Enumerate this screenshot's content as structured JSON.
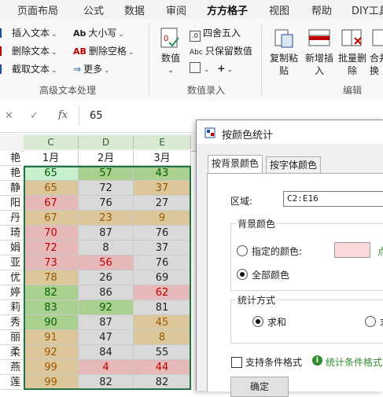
{
  "ribbon": {
    "tabs": [
      "页面布局",
      "公式",
      "数据",
      "审阅",
      "方方格子",
      "视图",
      "帮助",
      "DIY工具"
    ],
    "active_tab": "方方格子",
    "advanced_text": {
      "insert_text": "插入文本",
      "delete_text": "删除文本",
      "cut_text": "截取文本",
      "case": "大小写",
      "delete_spaces": "删除空格",
      "more": "更多",
      "caption": "高级文本处理"
    },
    "numeric": {
      "value": "数值",
      "round": "四舍五入",
      "keep_value": "只保留数值",
      "caption": "数值录入"
    },
    "edit": {
      "copy_paste": "复制粘贴",
      "new_insert": "新增插入",
      "batch_delete": "批量删除",
      "merge_transform": "合并转换",
      "caption": "编辑"
    }
  },
  "formula_bar": {
    "cancel_glyph": "✕",
    "confirm_glyph": "✓",
    "fx": "fx",
    "value": "65"
  },
  "grid": {
    "columns": [
      "C",
      "D",
      "E"
    ],
    "rows": [
      {
        "name": "艳",
        "c": "1月",
        "d": "2月",
        "e": "3月"
      },
      {
        "name": "艳",
        "c": "65",
        "d": "57",
        "e": "43"
      },
      {
        "name": "静",
        "c": "65",
        "d": "72",
        "e": "37"
      },
      {
        "name": "阳",
        "c": "67",
        "d": "76",
        "e": "27"
      },
      {
        "name": "丹",
        "c": "67",
        "d": "23",
        "e": "9"
      },
      {
        "name": "琦",
        "c": "70",
        "d": "87",
        "e": "76"
      },
      {
        "name": "娟",
        "c": "72",
        "d": "8",
        "e": "37"
      },
      {
        "name": "亚",
        "c": "73",
        "d": "56",
        "e": "76"
      },
      {
        "name": "优",
        "c": "78",
        "d": "26",
        "e": "69"
      },
      {
        "name": "婷",
        "c": "82",
        "d": "86",
        "e": "62"
      },
      {
        "name": "莉",
        "c": "83",
        "d": "92",
        "e": "81"
      },
      {
        "name": "秀",
        "c": "90",
        "d": "87",
        "e": "45"
      },
      {
        "name": "丽",
        "c": "91",
        "d": "47",
        "e": "8"
      },
      {
        "name": "柔",
        "c": "92",
        "d": "84",
        "e": "55"
      },
      {
        "name": "燕",
        "c": "99",
        "d": "4",
        "e": "44"
      },
      {
        "name": "莲",
        "c": "99",
        "d": "82",
        "e": "82"
      }
    ],
    "colors": {
      "green": "#a9d08e",
      "light_green": "#c6efce",
      "tan": "#dcc79a",
      "pink": "#e6b8b7",
      "gray": "#d9d9d9",
      "white": "#ffffff",
      "red_text": "#c00000",
      "orange_text": "#9c5700",
      "green_text": "#006100"
    }
  },
  "dialog": {
    "title": "按颜色统计",
    "tabs": [
      "按背景颜色",
      "按字体颜色"
    ],
    "range_label": "区域:",
    "range_value": "C2:E16",
    "bg_group": "背景颜色",
    "specified_color": "指定的颜色:",
    "specified_swatch": "#fcd9d9",
    "pick_suffix": "点",
    "all_colors": "全部颜色",
    "stat_group": "统计方式",
    "sum": "求和",
    "count": "求",
    "support_cf": "支持条件格式",
    "cf_note": "统计条件格式的",
    "ok": "确定"
  }
}
